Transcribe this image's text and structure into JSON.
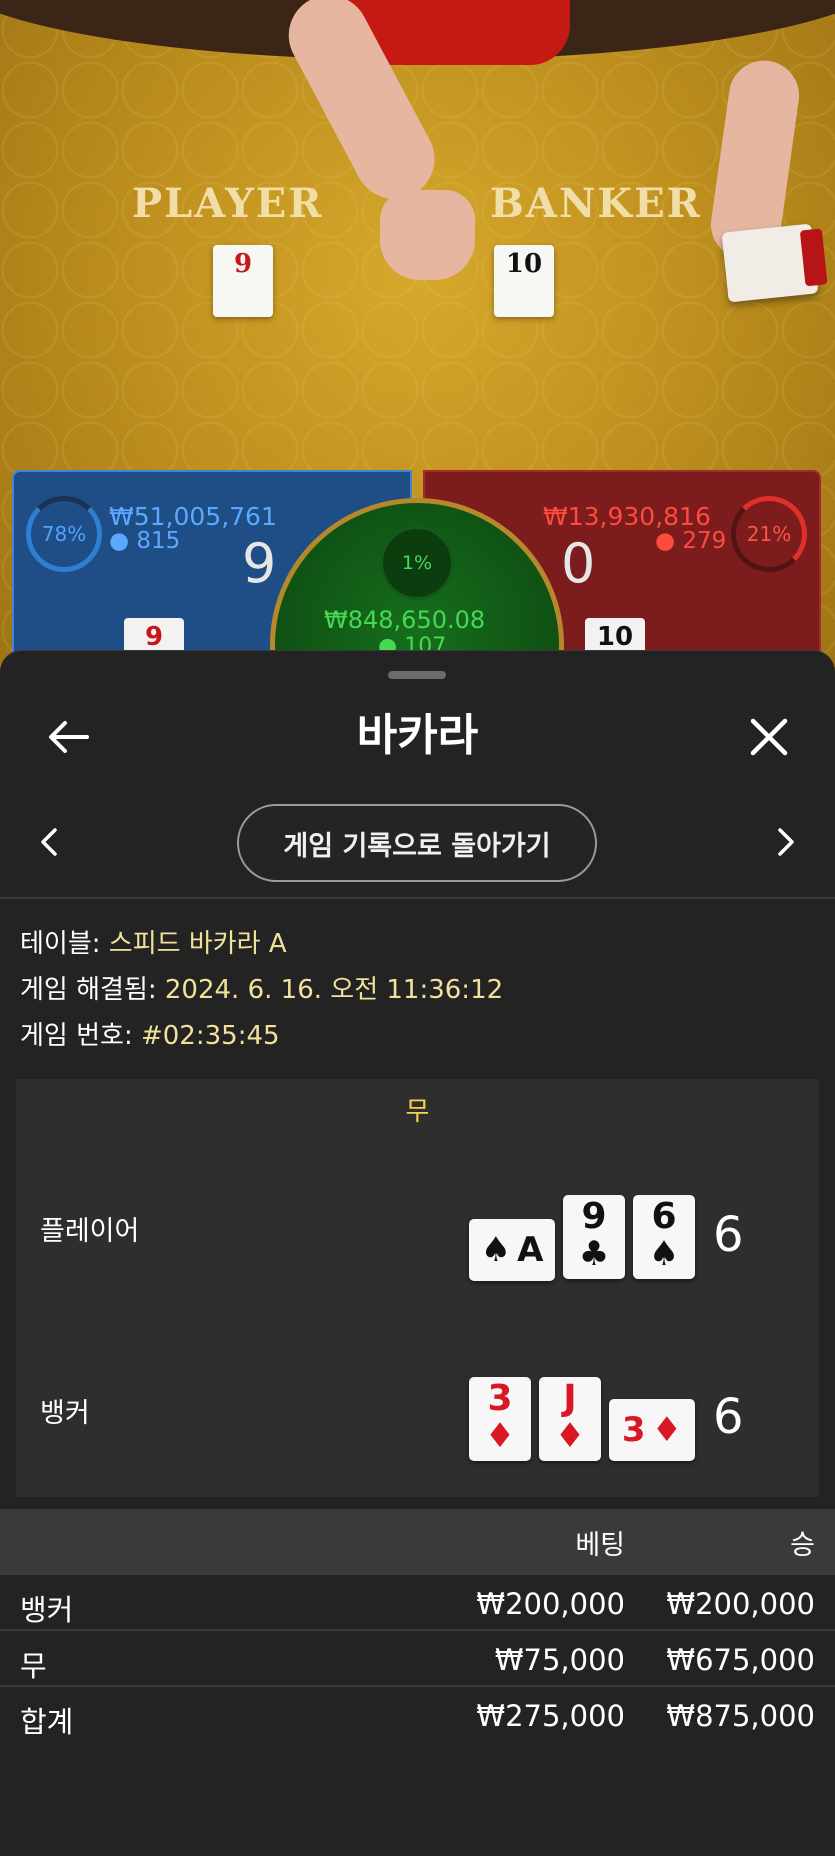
{
  "video": {
    "felt_player": "PLAYER",
    "felt_banker": "BANKER",
    "felt_player_card": "9",
    "felt_banker_card": "10"
  },
  "bet_panels": {
    "player": {
      "percent": "78%",
      "amount": "₩51,005,761",
      "count": "815",
      "score": "9",
      "card": "9"
    },
    "tie": {
      "percent": "1%",
      "amount": "₩848,650.08",
      "count": "107"
    },
    "banker": {
      "percent": "21%",
      "amount": "₩13,930,816",
      "count": "279",
      "score": "0",
      "card": "10"
    }
  },
  "sheet": {
    "title": "바카라",
    "back_icon": "arrow-left-icon",
    "close_icon": "close-icon",
    "nav": {
      "prev_icon": "chevron-left-icon",
      "next_icon": "chevron-right-icon",
      "history_button": "게임 기록으로 돌아가기"
    },
    "info": {
      "table_label": "테이블:",
      "table_value": "스피드 바카라 A",
      "resolved_label": "게임 해결됨:",
      "resolved_value": "2024. 6. 16. 오전 11:36:12",
      "game_no_label": "게임 번호:",
      "game_no_value": "#02:35:45"
    },
    "result": {
      "outcome": "무",
      "player": {
        "label": "플레이어",
        "score": "6",
        "cards": [
          {
            "rank": "A",
            "suit": "♠",
            "color": "#111111",
            "rotated": true
          },
          {
            "rank": "9",
            "suit": "♣",
            "color": "#111111",
            "rotated": false
          },
          {
            "rank": "6",
            "suit": "♠",
            "color": "#111111",
            "rotated": false
          }
        ]
      },
      "banker": {
        "label": "뱅커",
        "score": "6",
        "cards": [
          {
            "rank": "3",
            "suit": "♦",
            "color": "#d81824",
            "rotated": false
          },
          {
            "rank": "J",
            "suit": "♦",
            "color": "#d81824",
            "rotated": false
          },
          {
            "rank": "3",
            "suit": "♦",
            "color": "#d81824",
            "rotated": true
          }
        ]
      }
    },
    "bets_table": {
      "headers": {
        "bet": "베팅",
        "win": "승"
      },
      "rows": [
        {
          "name": "뱅커",
          "bet": "₩200,000",
          "win": "₩200,000"
        },
        {
          "name": "무",
          "bet": "₩75,000",
          "win": "₩675,000"
        },
        {
          "name": "합계",
          "bet": "₩275,000",
          "win": "₩875,000"
        }
      ]
    }
  }
}
